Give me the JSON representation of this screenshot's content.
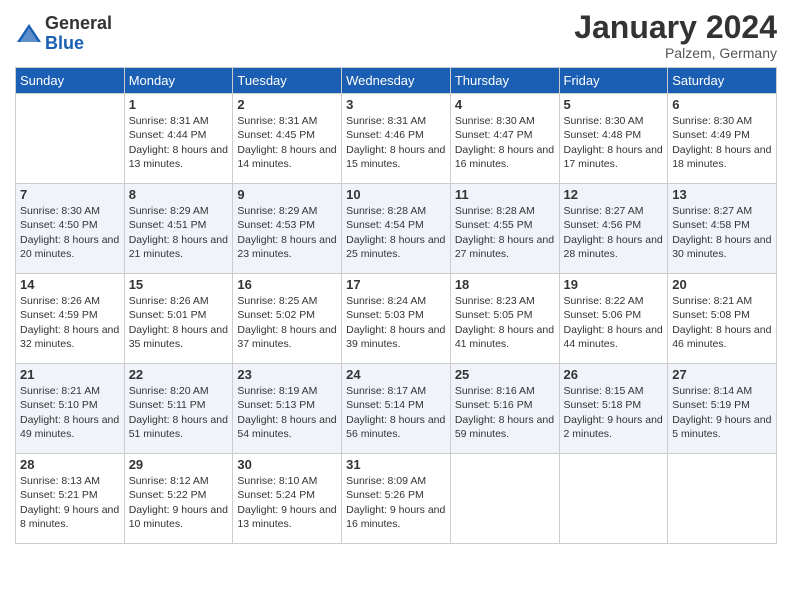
{
  "logo": {
    "general": "General",
    "blue": "Blue"
  },
  "title": "January 2024",
  "location": "Palzem, Germany",
  "days_of_week": [
    "Sunday",
    "Monday",
    "Tuesday",
    "Wednesday",
    "Thursday",
    "Friday",
    "Saturday"
  ],
  "weeks": [
    [
      {
        "day": "",
        "sunrise": "",
        "sunset": "",
        "daylight": ""
      },
      {
        "day": "1",
        "sunrise": "Sunrise: 8:31 AM",
        "sunset": "Sunset: 4:44 PM",
        "daylight": "Daylight: 8 hours and 13 minutes."
      },
      {
        "day": "2",
        "sunrise": "Sunrise: 8:31 AM",
        "sunset": "Sunset: 4:45 PM",
        "daylight": "Daylight: 8 hours and 14 minutes."
      },
      {
        "day": "3",
        "sunrise": "Sunrise: 8:31 AM",
        "sunset": "Sunset: 4:46 PM",
        "daylight": "Daylight: 8 hours and 15 minutes."
      },
      {
        "day": "4",
        "sunrise": "Sunrise: 8:30 AM",
        "sunset": "Sunset: 4:47 PM",
        "daylight": "Daylight: 8 hours and 16 minutes."
      },
      {
        "day": "5",
        "sunrise": "Sunrise: 8:30 AM",
        "sunset": "Sunset: 4:48 PM",
        "daylight": "Daylight: 8 hours and 17 minutes."
      },
      {
        "day": "6",
        "sunrise": "Sunrise: 8:30 AM",
        "sunset": "Sunset: 4:49 PM",
        "daylight": "Daylight: 8 hours and 18 minutes."
      }
    ],
    [
      {
        "day": "7",
        "sunrise": "Sunrise: 8:30 AM",
        "sunset": "Sunset: 4:50 PM",
        "daylight": "Daylight: 8 hours and 20 minutes."
      },
      {
        "day": "8",
        "sunrise": "Sunrise: 8:29 AM",
        "sunset": "Sunset: 4:51 PM",
        "daylight": "Daylight: 8 hours and 21 minutes."
      },
      {
        "day": "9",
        "sunrise": "Sunrise: 8:29 AM",
        "sunset": "Sunset: 4:53 PM",
        "daylight": "Daylight: 8 hours and 23 minutes."
      },
      {
        "day": "10",
        "sunrise": "Sunrise: 8:28 AM",
        "sunset": "Sunset: 4:54 PM",
        "daylight": "Daylight: 8 hours and 25 minutes."
      },
      {
        "day": "11",
        "sunrise": "Sunrise: 8:28 AM",
        "sunset": "Sunset: 4:55 PM",
        "daylight": "Daylight: 8 hours and 27 minutes."
      },
      {
        "day": "12",
        "sunrise": "Sunrise: 8:27 AM",
        "sunset": "Sunset: 4:56 PM",
        "daylight": "Daylight: 8 hours and 28 minutes."
      },
      {
        "day": "13",
        "sunrise": "Sunrise: 8:27 AM",
        "sunset": "Sunset: 4:58 PM",
        "daylight": "Daylight: 8 hours and 30 minutes."
      }
    ],
    [
      {
        "day": "14",
        "sunrise": "Sunrise: 8:26 AM",
        "sunset": "Sunset: 4:59 PM",
        "daylight": "Daylight: 8 hours and 32 minutes."
      },
      {
        "day": "15",
        "sunrise": "Sunrise: 8:26 AM",
        "sunset": "Sunset: 5:01 PM",
        "daylight": "Daylight: 8 hours and 35 minutes."
      },
      {
        "day": "16",
        "sunrise": "Sunrise: 8:25 AM",
        "sunset": "Sunset: 5:02 PM",
        "daylight": "Daylight: 8 hours and 37 minutes."
      },
      {
        "day": "17",
        "sunrise": "Sunrise: 8:24 AM",
        "sunset": "Sunset: 5:03 PM",
        "daylight": "Daylight: 8 hours and 39 minutes."
      },
      {
        "day": "18",
        "sunrise": "Sunrise: 8:23 AM",
        "sunset": "Sunset: 5:05 PM",
        "daylight": "Daylight: 8 hours and 41 minutes."
      },
      {
        "day": "19",
        "sunrise": "Sunrise: 8:22 AM",
        "sunset": "Sunset: 5:06 PM",
        "daylight": "Daylight: 8 hours and 44 minutes."
      },
      {
        "day": "20",
        "sunrise": "Sunrise: 8:21 AM",
        "sunset": "Sunset: 5:08 PM",
        "daylight": "Daylight: 8 hours and 46 minutes."
      }
    ],
    [
      {
        "day": "21",
        "sunrise": "Sunrise: 8:21 AM",
        "sunset": "Sunset: 5:10 PM",
        "daylight": "Daylight: 8 hours and 49 minutes."
      },
      {
        "day": "22",
        "sunrise": "Sunrise: 8:20 AM",
        "sunset": "Sunset: 5:11 PM",
        "daylight": "Daylight: 8 hours and 51 minutes."
      },
      {
        "day": "23",
        "sunrise": "Sunrise: 8:19 AM",
        "sunset": "Sunset: 5:13 PM",
        "daylight": "Daylight: 8 hours and 54 minutes."
      },
      {
        "day": "24",
        "sunrise": "Sunrise: 8:17 AM",
        "sunset": "Sunset: 5:14 PM",
        "daylight": "Daylight: 8 hours and 56 minutes."
      },
      {
        "day": "25",
        "sunrise": "Sunrise: 8:16 AM",
        "sunset": "Sunset: 5:16 PM",
        "daylight": "Daylight: 8 hours and 59 minutes."
      },
      {
        "day": "26",
        "sunrise": "Sunrise: 8:15 AM",
        "sunset": "Sunset: 5:18 PM",
        "daylight": "Daylight: 9 hours and 2 minutes."
      },
      {
        "day": "27",
        "sunrise": "Sunrise: 8:14 AM",
        "sunset": "Sunset: 5:19 PM",
        "daylight": "Daylight: 9 hours and 5 minutes."
      }
    ],
    [
      {
        "day": "28",
        "sunrise": "Sunrise: 8:13 AM",
        "sunset": "Sunset: 5:21 PM",
        "daylight": "Daylight: 9 hours and 8 minutes."
      },
      {
        "day": "29",
        "sunrise": "Sunrise: 8:12 AM",
        "sunset": "Sunset: 5:22 PM",
        "daylight": "Daylight: 9 hours and 10 minutes."
      },
      {
        "day": "30",
        "sunrise": "Sunrise: 8:10 AM",
        "sunset": "Sunset: 5:24 PM",
        "daylight": "Daylight: 9 hours and 13 minutes."
      },
      {
        "day": "31",
        "sunrise": "Sunrise: 8:09 AM",
        "sunset": "Sunset: 5:26 PM",
        "daylight": "Daylight: 9 hours and 16 minutes."
      },
      {
        "day": "",
        "sunrise": "",
        "sunset": "",
        "daylight": ""
      },
      {
        "day": "",
        "sunrise": "",
        "sunset": "",
        "daylight": ""
      },
      {
        "day": "",
        "sunrise": "",
        "sunset": "",
        "daylight": ""
      }
    ]
  ]
}
